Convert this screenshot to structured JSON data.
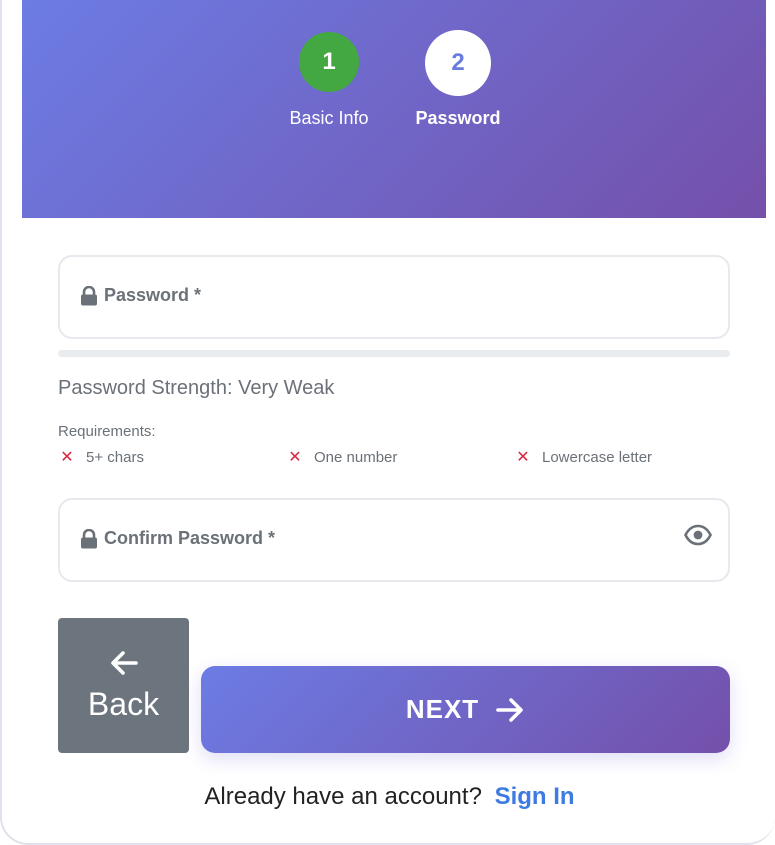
{
  "stepper": {
    "steps": [
      {
        "number": "1",
        "label": "Basic Info",
        "status": "complete"
      },
      {
        "number": "2",
        "label": "Password",
        "status": "active"
      }
    ]
  },
  "form": {
    "password_label": "Password *",
    "strength_text": "Password Strength: Very Weak",
    "strength_fraction": 0,
    "requirements_title": "Requirements:",
    "requirements": [
      {
        "label": "5+ chars",
        "met": false
      },
      {
        "label": "One number",
        "met": false
      },
      {
        "label": "Lowercase letter",
        "met": false
      }
    ],
    "confirm_label": "Confirm Password *",
    "requirement_fail_symbol": "✕",
    "icons": {
      "field_icon": "lock-icon",
      "toggle_visibility": "eye-icon",
      "requirement_fail": "x-icon"
    }
  },
  "actions": {
    "back_label": "Back",
    "next_label": "NEXT"
  },
  "footer": {
    "prompt": "Already have an account?",
    "link": "Sign In"
  },
  "colors": {
    "gradient_start": "#6c7ce4",
    "gradient_end": "#7450aa",
    "step_complete": "#43a841",
    "back_button": "#6c757d",
    "link": "#3d7be2",
    "requirement_fail": "#d9263d"
  }
}
